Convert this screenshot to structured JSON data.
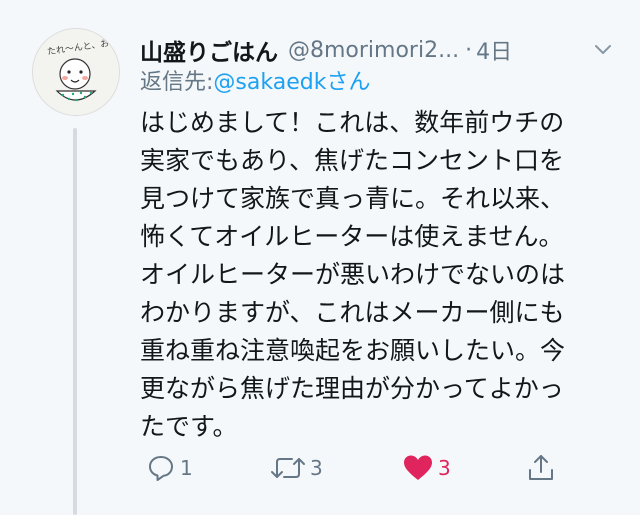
{
  "tweet": {
    "name": "山盛りごはん",
    "handle": "@8morimori2...",
    "separator": "·",
    "time": "4日",
    "reply_label": "返信先:",
    "reply_mention": "@sakaedkさん",
    "body_lines": [
      "はじめまして！これは、数年前ウチの",
      "実家でもあり、焦げたコンセント口を",
      "見つけて家族で真っ青に。それ以来、",
      "怖くてオイルヒーターは使えません。",
      "オイルヒーターが悪いわけでないのは",
      "わかりますが、これはメーカー側にも",
      "重ね重ね注意喚起をお願いしたい。今",
      "更ながら焦げた理由が分かってよかっ",
      "たです。"
    ],
    "avatar_text": "たれ〜んと、お食べ"
  },
  "actions": {
    "reply_count": "1",
    "retweet_count": "3",
    "like_count": "3",
    "like_color": "#e0245e",
    "icons": [
      "reply-icon",
      "retweet-icon",
      "heart-icon",
      "share-icon"
    ]
  },
  "colors": {
    "background": "#f5f8fa",
    "text": "#14171a",
    "secondary": "#657786",
    "link": "#1da1f2",
    "thread_line": "#d5dbe0"
  }
}
